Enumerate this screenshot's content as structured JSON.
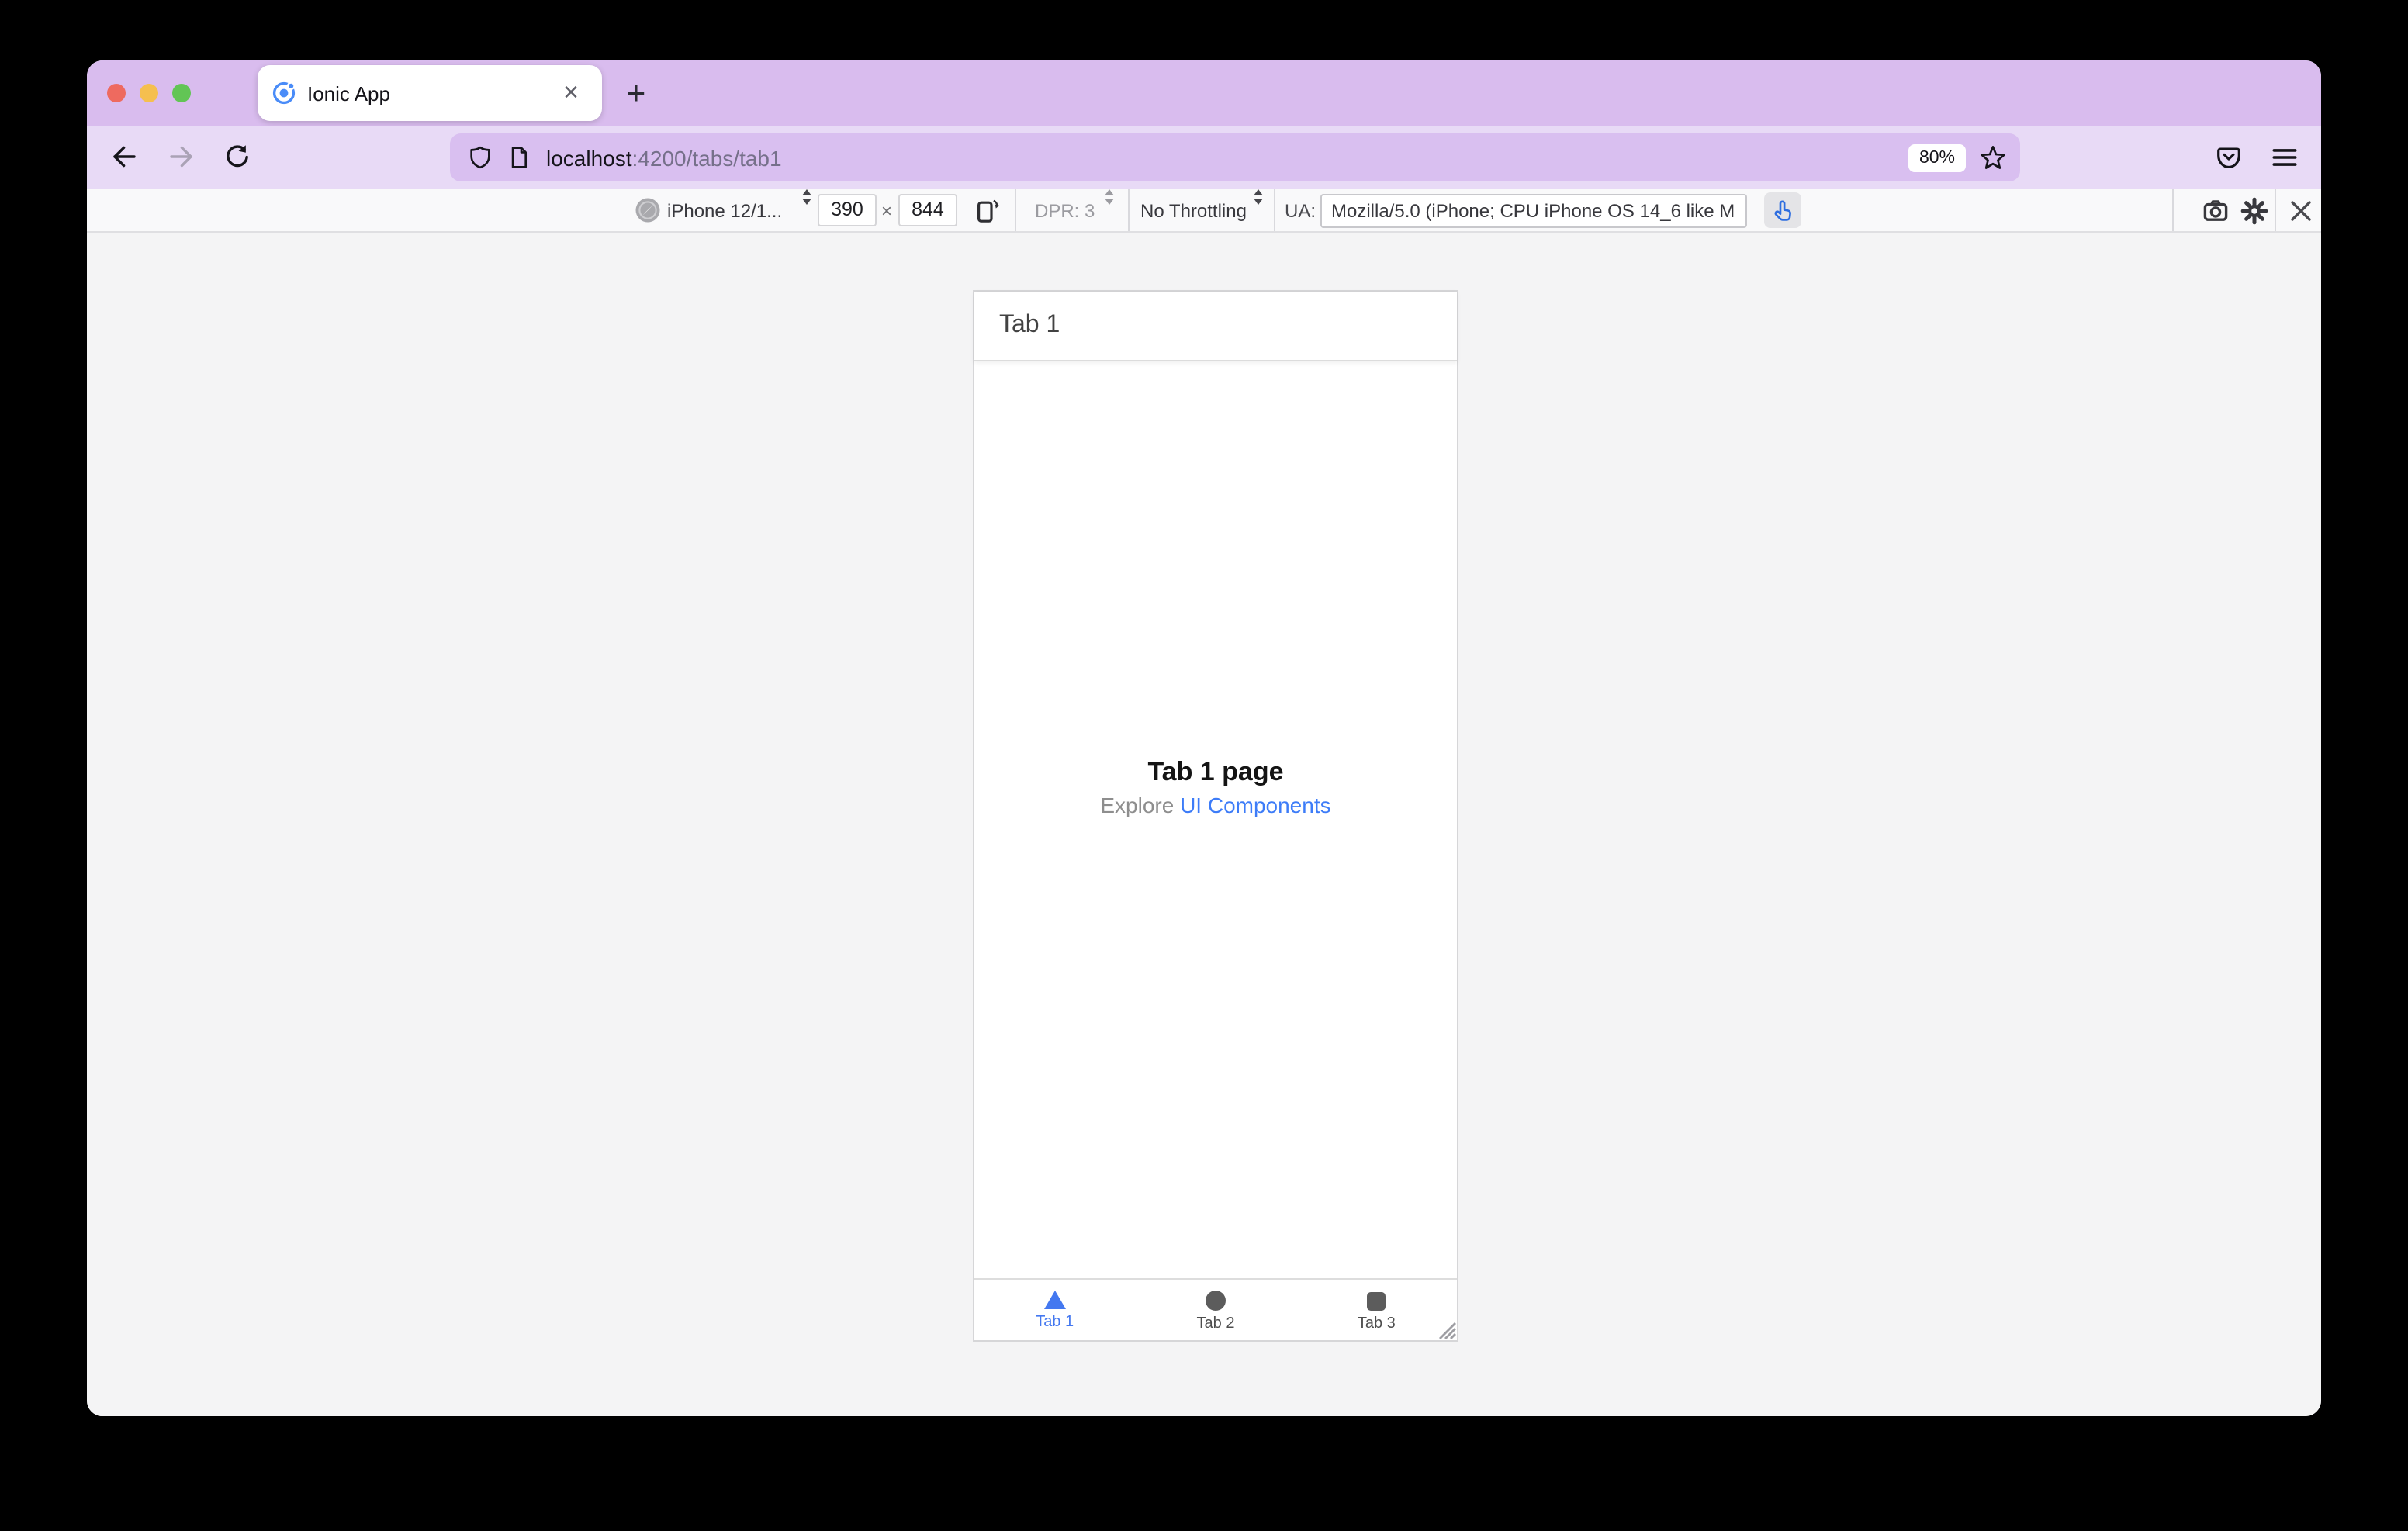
{
  "browser": {
    "tab": {
      "title": "Ionic App",
      "close_glyph": "✕"
    },
    "new_tab_glyph": "+",
    "url": {
      "host": "localhost",
      "path": ":4200/tabs/tab1"
    },
    "zoom_badge": "80%"
  },
  "rdm_toolbar": {
    "device_name": "iPhone 12/1...",
    "viewport_width": "390",
    "dimension_separator": "×",
    "viewport_height": "844",
    "dpr": "DPR: 3",
    "throttling": "No Throttling",
    "ua_label": "UA:",
    "ua_value": "Mozilla/5.0 (iPhone; CPU iPhone OS 14_6 like M"
  },
  "app": {
    "header_title": "Tab 1",
    "page_title": "Tab 1 page",
    "subtitle_text": "Explore ",
    "subtitle_link": "UI Components",
    "tab_bar": [
      {
        "label": "Tab 1",
        "active": true
      },
      {
        "label": "Tab 2",
        "active": false
      },
      {
        "label": "Tab 3",
        "active": false
      }
    ]
  },
  "colors": {
    "titlebar_purple": "#d9bcee",
    "toolbar_purple": "#e8daf6",
    "urlbar_purple": "#d9bff0",
    "accent_blue": "#3d7cf8",
    "active_tab_blue": "#4478f0",
    "inactive_gray": "#5c5c5c"
  }
}
